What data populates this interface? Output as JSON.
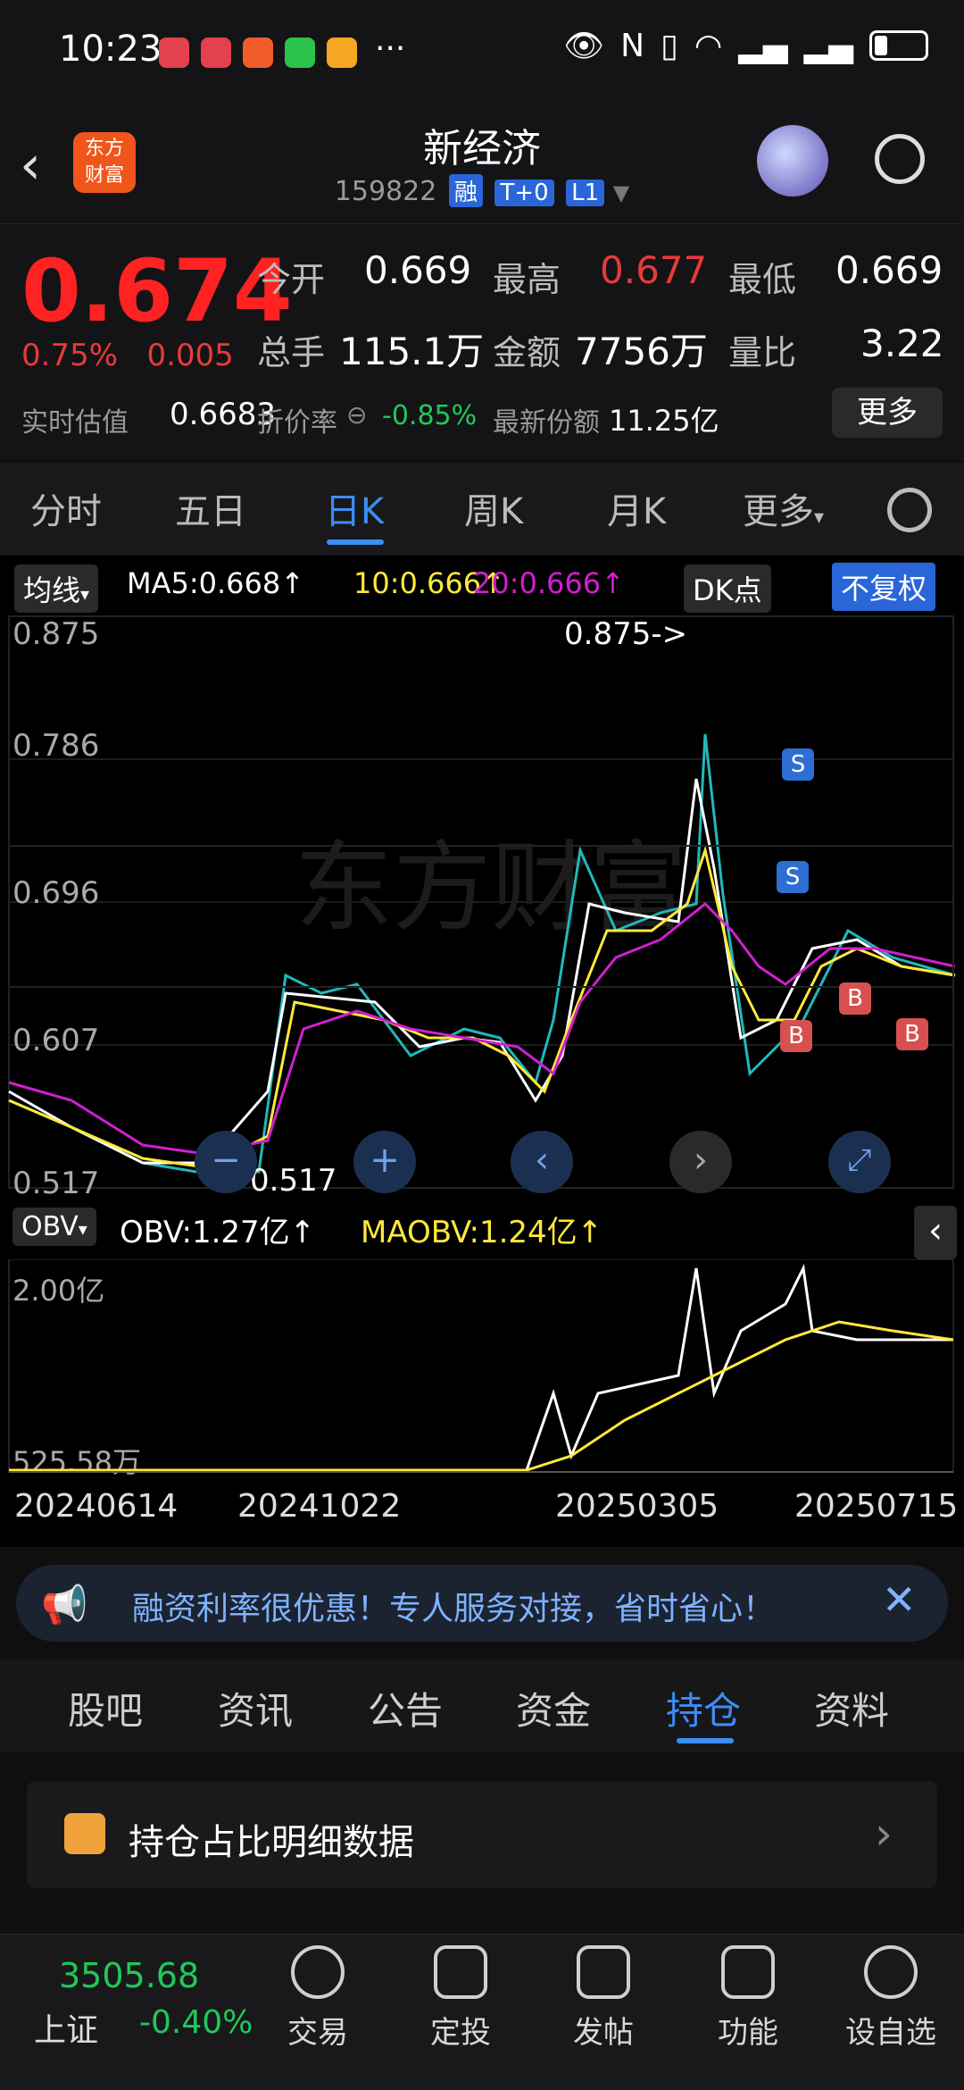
{
  "status": {
    "time": "10:23",
    "more": "···"
  },
  "header": {
    "title": "新经济",
    "code": "159822",
    "tags": [
      "融",
      "T+0",
      "L1"
    ],
    "logo_text": "东方\n财富"
  },
  "quote": {
    "price": "0.674",
    "pct": "0.75%",
    "chg": "0.005",
    "open_l": "今开",
    "open_v": "0.669",
    "high_l": "最高",
    "high_v": "0.677",
    "low_l": "最低",
    "low_v": "0.669",
    "vol_l": "总手",
    "vol_v": "115.1万",
    "amt_l": "金额",
    "amt_v": "7756万",
    "ratio_l": "量比",
    "ratio_v": "3.22",
    "est_l": "实时估值",
    "est_v": "0.6683",
    "disc_l": "折价率",
    "disc_v": "-0.85%",
    "share_l": "最新份额",
    "share_v": "11.25亿",
    "more": "更多"
  },
  "ktabs": [
    "分时",
    "五日",
    "日K",
    "周K",
    "月K",
    "更多"
  ],
  "chart": {
    "ma_sel": "均线",
    "ma5": "MA5:0.668↑",
    "ma10": "10:0.666↑",
    "ma20": "20:0.666↑",
    "dk": "DK点",
    "fq": "不复权",
    "y_labels": [
      "0.875",
      "0.786",
      "0.696",
      "0.607",
      "0.517"
    ],
    "max_note": "0.875->",
    "min_note": "0.517",
    "obv_sel": "OBV",
    "obv": "OBV:1.27亿↑",
    "maobv": "MAOBV:1.24亿↑",
    "obv_max": "2.00亿",
    "obv_min": "525.58万",
    "dates": [
      "20240614",
      "20241022",
      "20250305",
      "20250715"
    ],
    "colors": {
      "ma5": "#ffffff",
      "ma10": "#ffe93b",
      "ma20": "#d21ed2"
    }
  },
  "banner": {
    "text": "融资利率很优惠！专人服务对接，省时省心！"
  },
  "btabs": [
    "股吧",
    "资讯",
    "公告",
    "资金",
    "持仓",
    "资料"
  ],
  "holding": {
    "title": "持仓占比明细数据"
  },
  "index": {
    "value": "3505.68",
    "name": "上证",
    "chg": "-0.40%"
  },
  "bottom": [
    "交易",
    "定投",
    "发帖",
    "功能",
    "设自选"
  ]
}
